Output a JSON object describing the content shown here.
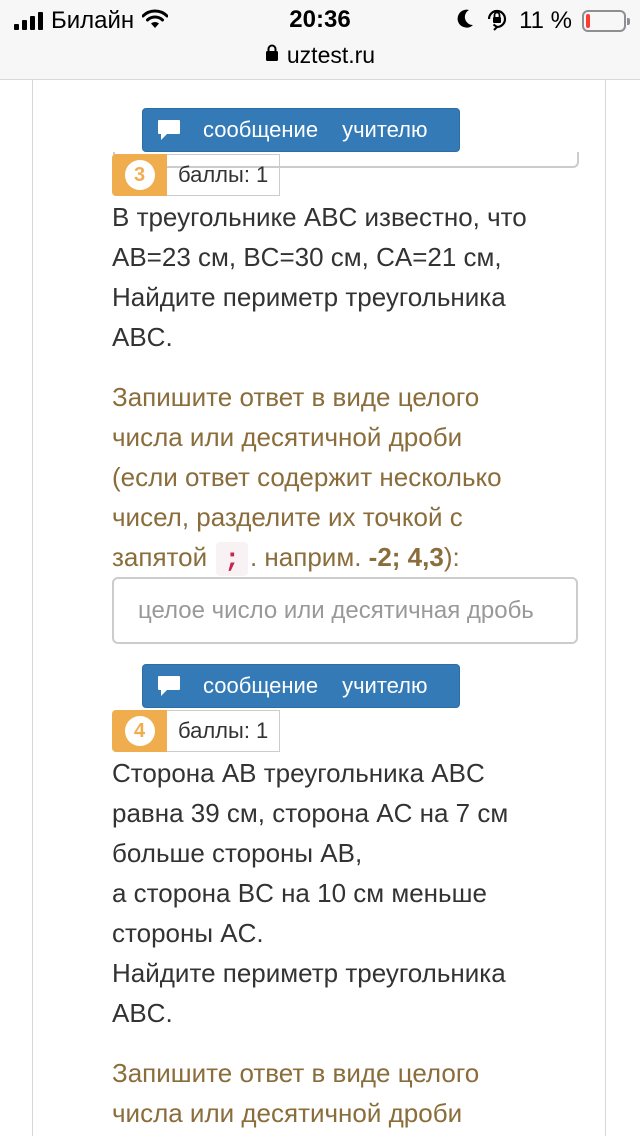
{
  "status_bar": {
    "carrier": "Билайн",
    "time": "20:36",
    "battery_percent": "11 %",
    "battery_level": 0.11,
    "url": "uztest.ru",
    "icons": [
      "signal-icon",
      "wifi-icon",
      "moon-icon",
      "orientation-lock-icon",
      "battery-icon",
      "lock-icon"
    ]
  },
  "colors": {
    "button": "#337ab7",
    "badge": "#f0ad4e",
    "hint_text": "#8a6d3b",
    "semicolon": "#c7254e"
  },
  "questions": [
    {
      "message_button": {
        "word1": "сообщение",
        "word2": "учителю",
        "icon": "speech-bubble-icon"
      },
      "number": "3",
      "points": "баллы: 1",
      "text_lines": [
        "В треугольнике ABC известно, что",
        "AB=23 см, BC=30 см, CA=21 см,",
        "Найдите периметр треугольника",
        "ABC."
      ],
      "hint": {
        "lines": [
          "Запишите ответ в виде целого",
          "числа или десятичной дроби",
          "(если ответ содержит несколько",
          "чисел, разделите их точкой с"
        ],
        "last_prefix": "запятой",
        "semicolon": ";",
        "example_label": ". наприм.",
        "example_value": "-2; 4,3",
        "closing": "):"
      },
      "answer": {
        "value": "",
        "placeholder": "целое число или десятичная дробь"
      }
    },
    {
      "message_button": {
        "word1": "сообщение",
        "word2": "учителю",
        "icon": "speech-bubble-icon"
      },
      "number": "4",
      "points": "баллы: 1",
      "text_lines": [
        "Сторона AB треугольника ABC",
        "равна 39 см, сторона AC на 7 см",
        "больше стороны AB,",
        "а сторона BC на 10 см меньше",
        "стороны AC.",
        "Найдите периметр треугольника",
        "ABC."
      ],
      "hint": {
        "lines": [
          "Запишите ответ в виде целого",
          "числа или десятичной дроби"
        ]
      }
    }
  ]
}
